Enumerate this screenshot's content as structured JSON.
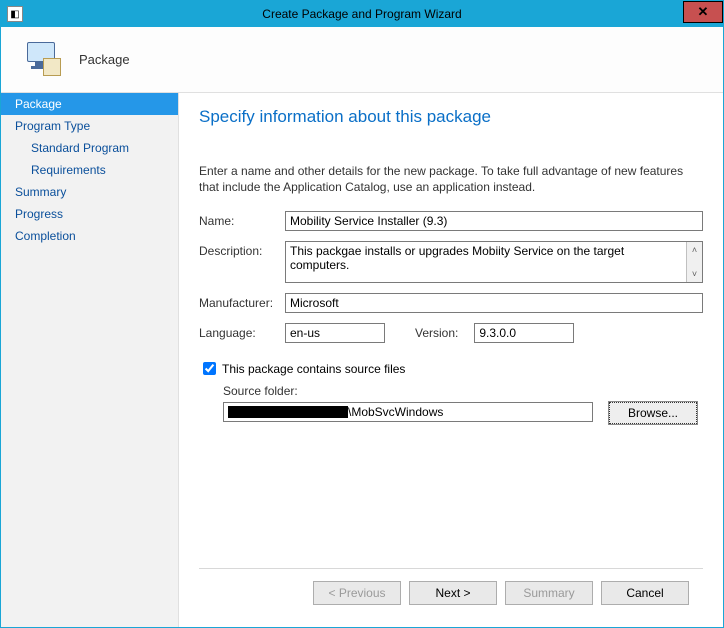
{
  "window": {
    "title": "Create Package and Program Wizard",
    "close_glyph": "✕"
  },
  "header": {
    "title": "Package"
  },
  "sidebar": {
    "items": [
      {
        "label": "Package",
        "selected": true,
        "sub": false
      },
      {
        "label": "Program Type",
        "selected": false,
        "sub": false
      },
      {
        "label": "Standard Program",
        "selected": false,
        "sub": true
      },
      {
        "label": "Requirements",
        "selected": false,
        "sub": true
      },
      {
        "label": "Summary",
        "selected": false,
        "sub": false
      },
      {
        "label": "Progress",
        "selected": false,
        "sub": false
      },
      {
        "label": "Completion",
        "selected": false,
        "sub": false
      }
    ]
  },
  "page": {
    "heading": "Specify information about this package",
    "intro": "Enter a name and other details for the new package. To take full advantage of new features that include the Application Catalog, use an application instead.",
    "labels": {
      "name": "Name:",
      "description": "Description:",
      "manufacturer": "Manufacturer:",
      "language": "Language:",
      "version": "Version:",
      "source_checkbox": "This package contains source files",
      "source_folder": "Source folder:",
      "browse": "Browse..."
    },
    "values": {
      "name": "Mobility Service Installer (9.3)",
      "description": "This packgae installs or upgrades Mobiity Service on the target computers.",
      "manufacturer": "Microsoft",
      "language": "en-us",
      "version": "9.3.0.0",
      "source_checked": true,
      "source_suffix": "\\MobSvcWindows"
    }
  },
  "footer": {
    "previous": "< Previous",
    "next": "Next >",
    "summary": "Summary",
    "cancel": "Cancel"
  }
}
